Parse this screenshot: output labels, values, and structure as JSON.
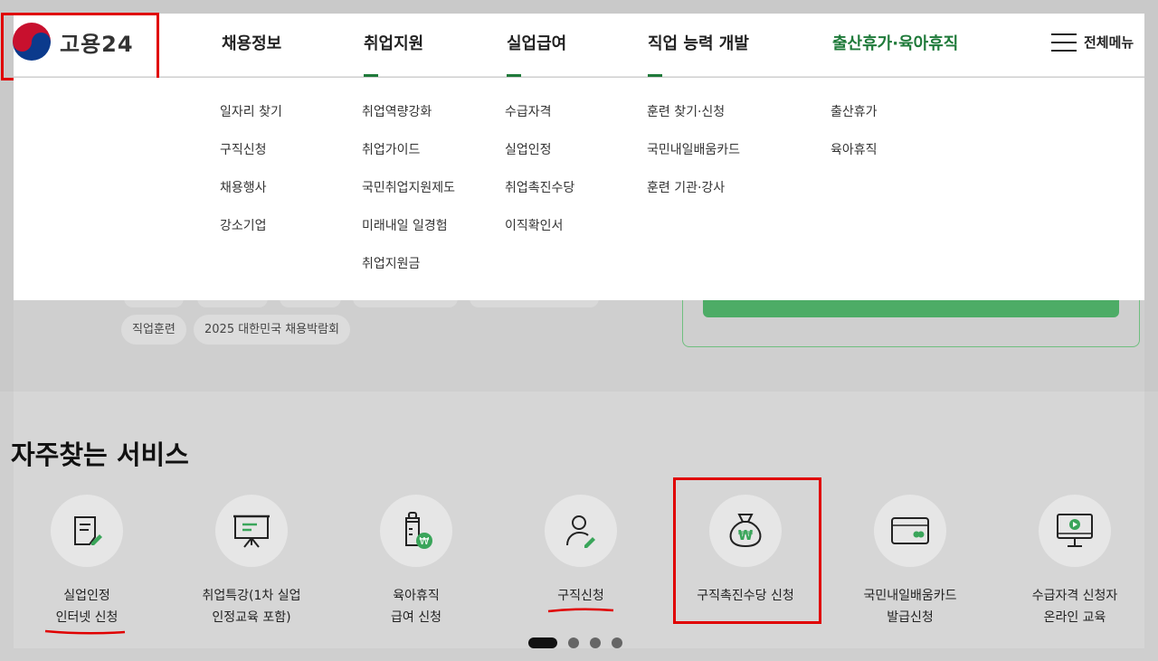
{
  "logo": {
    "text": "고용24"
  },
  "nav": [
    {
      "label": "채용정보"
    },
    {
      "label": "취업지원"
    },
    {
      "label": "실업급여"
    },
    {
      "label": "직업 능력 개발"
    },
    {
      "label": "출산휴가·육아휴직"
    }
  ],
  "all_menu": {
    "label": "전체메뉴",
    "icon": "hamburger-icon"
  },
  "submenu": {
    "col1": [
      "일자리 찾기",
      "구직신청",
      "채용행사",
      "강소기업"
    ],
    "col2": [
      "취업역량강화",
      "취업가이드",
      "국민취업지원제도",
      "미래내일 일경험",
      "취업지원금"
    ],
    "col3": [
      "수급자격",
      "실업인정",
      "취업촉진수당",
      "이직확인서"
    ],
    "col4": [
      "훈련 찾기·신청",
      "국민내일배움카드",
      "훈련 기관·강사"
    ],
    "col5": [
      "출산휴가",
      "육아휴직"
    ]
  },
  "chips": [
    "직업훈련",
    "2025 대한민국 채용박람회"
  ],
  "services": {
    "title": "자주찾는 서비스",
    "items": [
      {
        "line1": "실업인정",
        "line2": "인터넷 신청",
        "icon": "document-pen-icon"
      },
      {
        "line1": "취업특강(1차 실업",
        "line2": "인정교육 포함)",
        "icon": "presentation-board-icon"
      },
      {
        "line1": "육아휴직",
        "line2": "급여 신청",
        "icon": "baby-bottle-won-icon"
      },
      {
        "line1": "구직신청",
        "line2": "",
        "icon": "person-pen-icon"
      },
      {
        "line1": "구직촉진수당 신청",
        "line2": "",
        "icon": "money-bag-won-icon"
      },
      {
        "line1": "국민내일배움카드",
        "line2": "발급신청",
        "icon": "card-icon"
      },
      {
        "line1": "수급자격 신청자",
        "line2": "온라인 교육",
        "icon": "monitor-play-icon"
      }
    ]
  },
  "pagination": {
    "pages": 4,
    "active": 1
  },
  "colors": {
    "brand_green": "#1f7a3a",
    "accent_green": "#4dac66",
    "annotation_red": "#e00000"
  }
}
